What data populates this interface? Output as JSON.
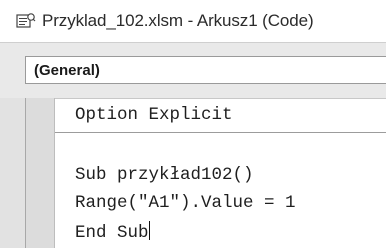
{
  "window": {
    "title": "Przyklad_102.xlsm - Arkusz1 (Code)",
    "icon": "vba-module-icon"
  },
  "object_combo": {
    "value": "(General)"
  },
  "code": {
    "lines": [
      "Option Explicit",
      "Sub przykład102()",
      "Range(\"A1\").Value = 1",
      "End Sub"
    ]
  }
}
